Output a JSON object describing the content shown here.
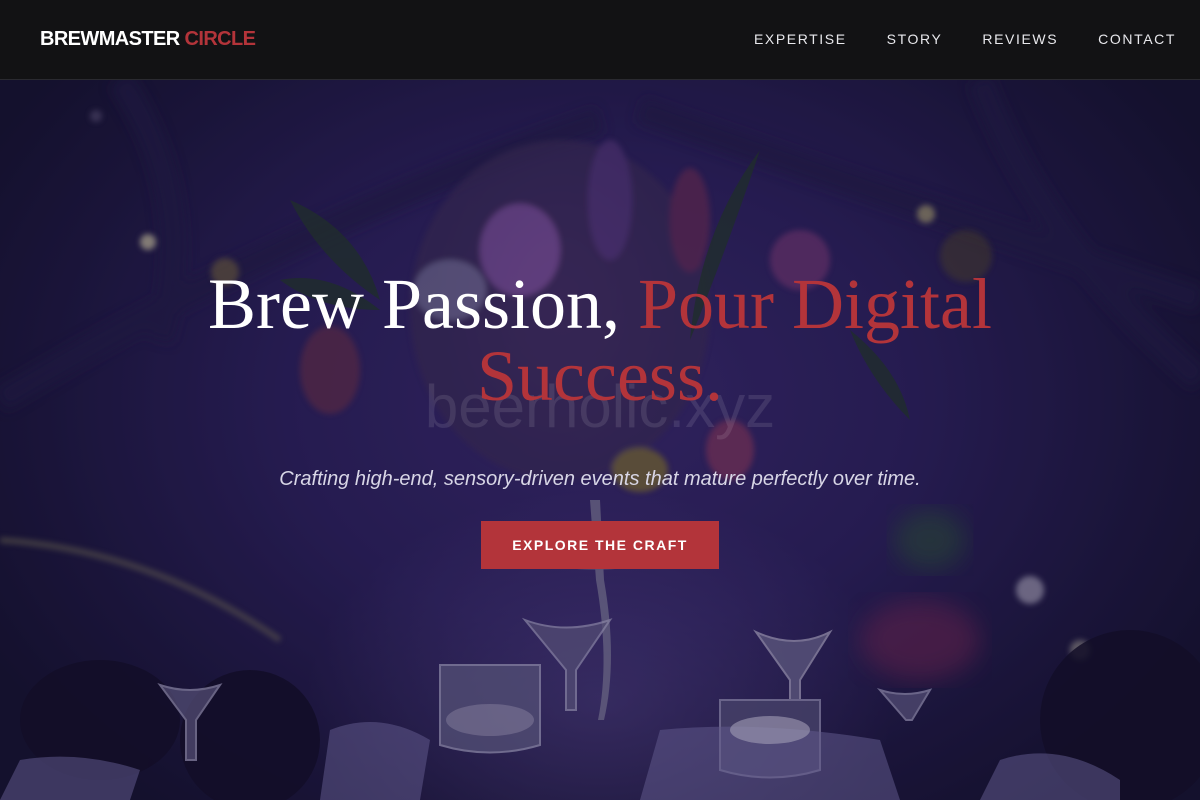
{
  "brand": {
    "name_main": "BREWMASTER",
    "name_accent": "CIRCLE"
  },
  "nav": {
    "items": [
      {
        "label": "EXPERTISE"
      },
      {
        "label": "STORY"
      },
      {
        "label": "REVIEWS"
      },
      {
        "label": "CONTACT"
      }
    ]
  },
  "hero": {
    "headline_main": "Brew Passion, ",
    "headline_accent": "Pour Digital Success.",
    "tagline": "Crafting high-end, sensory-driven events that mature perfectly over time.",
    "cta_label": "EXPLORE THE CRAFT",
    "watermark": "beerholic.xyz",
    "background_image": "dim banquet table with floral centerpiece and glassware"
  },
  "colors": {
    "accent": "#b3343a",
    "header_bg": "#121214",
    "hero_tint": "#2c2160"
  }
}
